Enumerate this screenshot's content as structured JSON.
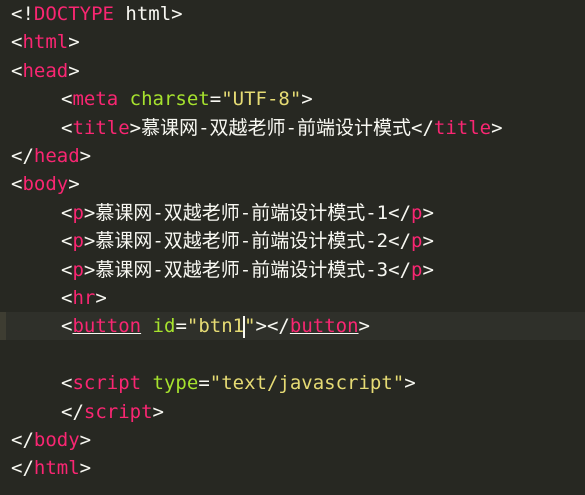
{
  "editor": {
    "colors": {
      "background": "#272822",
      "tag": "#f92672",
      "attribute": "#a6e22e",
      "string": "#e6db74",
      "text": "#f8f8f2"
    },
    "lines": [
      {
        "indent": 0,
        "tokens": [
          {
            "t": "punct",
            "v": "<!"
          },
          {
            "t": "doctype",
            "v": "DOCTYPE"
          },
          {
            "t": "text",
            "v": " html"
          },
          {
            "t": "punct",
            "v": ">"
          }
        ]
      },
      {
        "indent": 0,
        "tokens": [
          {
            "t": "punct",
            "v": "<"
          },
          {
            "t": "tag",
            "v": "html"
          },
          {
            "t": "punct",
            "v": ">"
          }
        ]
      },
      {
        "indent": 0,
        "tokens": [
          {
            "t": "punct",
            "v": "<"
          },
          {
            "t": "tag",
            "v": "head"
          },
          {
            "t": "punct",
            "v": ">"
          }
        ]
      },
      {
        "indent": 1,
        "tokens": [
          {
            "t": "punct",
            "v": "<"
          },
          {
            "t": "tag",
            "v": "meta"
          },
          {
            "t": "text",
            "v": " "
          },
          {
            "t": "attr",
            "v": "charset"
          },
          {
            "t": "punct",
            "v": "="
          },
          {
            "t": "str",
            "v": "\"UTF-8\""
          },
          {
            "t": "punct",
            "v": ">"
          }
        ]
      },
      {
        "indent": 1,
        "tokens": [
          {
            "t": "punct",
            "v": "<"
          },
          {
            "t": "tag",
            "v": "title"
          },
          {
            "t": "punct",
            "v": ">"
          },
          {
            "t": "text",
            "v": "慕课网-双越老师-前端设计模式"
          },
          {
            "t": "punct",
            "v": "</"
          },
          {
            "t": "tag",
            "v": "title"
          },
          {
            "t": "punct",
            "v": ">"
          }
        ]
      },
      {
        "indent": 0,
        "tokens": [
          {
            "t": "punct",
            "v": "</"
          },
          {
            "t": "tag",
            "v": "head"
          },
          {
            "t": "punct",
            "v": ">"
          }
        ]
      },
      {
        "indent": 0,
        "tokens": [
          {
            "t": "punct",
            "v": "<"
          },
          {
            "t": "tag",
            "v": "body"
          },
          {
            "t": "punct",
            "v": ">"
          }
        ]
      },
      {
        "indent": 1,
        "tokens": [
          {
            "t": "punct",
            "v": "<"
          },
          {
            "t": "tag",
            "v": "p"
          },
          {
            "t": "punct",
            "v": ">"
          },
          {
            "t": "text",
            "v": "慕课网-双越老师-前端设计模式-1"
          },
          {
            "t": "punct",
            "v": "</"
          },
          {
            "t": "tag",
            "v": "p"
          },
          {
            "t": "punct",
            "v": ">"
          }
        ]
      },
      {
        "indent": 1,
        "tokens": [
          {
            "t": "punct",
            "v": "<"
          },
          {
            "t": "tag",
            "v": "p"
          },
          {
            "t": "punct",
            "v": ">"
          },
          {
            "t": "text",
            "v": "慕课网-双越老师-前端设计模式-2"
          },
          {
            "t": "punct",
            "v": "</"
          },
          {
            "t": "tag",
            "v": "p"
          },
          {
            "t": "punct",
            "v": ">"
          }
        ]
      },
      {
        "indent": 1,
        "tokens": [
          {
            "t": "punct",
            "v": "<"
          },
          {
            "t": "tag",
            "v": "p"
          },
          {
            "t": "punct",
            "v": ">"
          },
          {
            "t": "text",
            "v": "慕课网-双越老师-前端设计模式-3"
          },
          {
            "t": "punct",
            "v": "</"
          },
          {
            "t": "tag",
            "v": "p"
          },
          {
            "t": "punct",
            "v": ">"
          }
        ]
      },
      {
        "indent": 1,
        "tokens": [
          {
            "t": "punct",
            "v": "<"
          },
          {
            "t": "tag",
            "v": "hr"
          },
          {
            "t": "punct",
            "v": ">"
          }
        ]
      },
      {
        "indent": 1,
        "active": true,
        "tokens": [
          {
            "t": "punct",
            "v": "<"
          },
          {
            "t": "tag",
            "v": "button",
            "u": true
          },
          {
            "t": "text",
            "v": " "
          },
          {
            "t": "attr",
            "v": "id"
          },
          {
            "t": "punct",
            "v": "="
          },
          {
            "t": "str",
            "v": "\"btn1"
          },
          {
            "t": "cursor",
            "v": ""
          },
          {
            "t": "str",
            "v": "\""
          },
          {
            "t": "punct",
            "v": "></"
          },
          {
            "t": "tag",
            "v": "button",
            "u": true
          },
          {
            "t": "punct",
            "v": ">"
          }
        ]
      },
      {
        "indent": 0,
        "tokens": []
      },
      {
        "indent": 1,
        "tokens": [
          {
            "t": "punct",
            "v": "<"
          },
          {
            "t": "tag",
            "v": "script"
          },
          {
            "t": "text",
            "v": " "
          },
          {
            "t": "attr",
            "v": "type"
          },
          {
            "t": "punct",
            "v": "="
          },
          {
            "t": "str",
            "v": "\"text/javascript\""
          },
          {
            "t": "punct",
            "v": ">"
          }
        ]
      },
      {
        "indent": 1,
        "tokens": [
          {
            "t": "punct",
            "v": "</"
          },
          {
            "t": "tag",
            "v": "script"
          },
          {
            "t": "punct",
            "v": ">"
          }
        ]
      },
      {
        "indent": 0,
        "tokens": [
          {
            "t": "punct",
            "v": "</"
          },
          {
            "t": "tag",
            "v": "body"
          },
          {
            "t": "punct",
            "v": ">"
          }
        ]
      },
      {
        "indent": 0,
        "tokens": [
          {
            "t": "punct",
            "v": "</"
          },
          {
            "t": "tag",
            "v": "html"
          },
          {
            "t": "punct",
            "v": ">"
          }
        ]
      }
    ]
  }
}
